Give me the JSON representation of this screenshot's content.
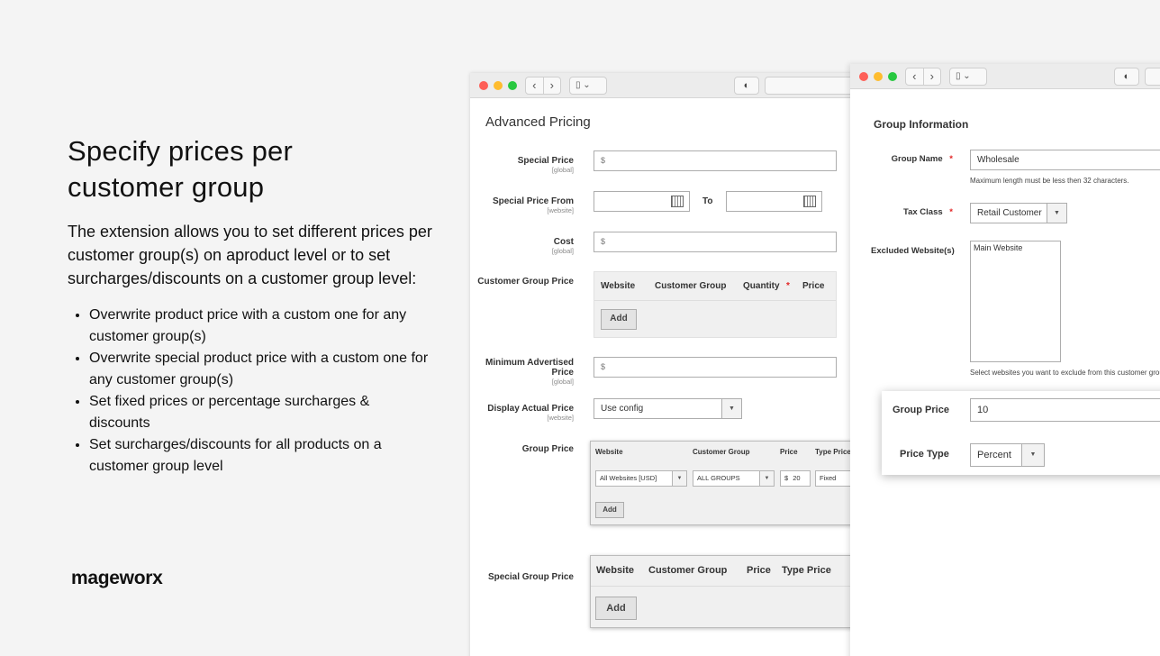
{
  "marketing": {
    "headline": "Specify prices per customer group",
    "intro": "The extension allows you to set different prices per customer group(s) on aproduct level or to set surcharges/discounts on a customer group level:",
    "bullets": [
      "Overwrite product price with a custom one for any customer group(s)",
      "Overwrite special product price with a custom one for any customer group(s)",
      "Set fixed prices or percentage surcharges & discounts",
      "Set surcharges/discounts for all products on a customer group level"
    ],
    "brand": "mageworx"
  },
  "browser": {
    "back_glyph": "‹",
    "forward_glyph": "›",
    "sidebar_glyph": "▯ ⌄",
    "shield_glyph": "◐"
  },
  "advanced_pricing": {
    "title": "Advanced Pricing",
    "special_price": {
      "label": "Special Price",
      "scope": "[global]",
      "prefix": "$"
    },
    "special_price_from": {
      "label": "Special Price From",
      "scope": "[website]",
      "to_label": "To"
    },
    "cost": {
      "label": "Cost",
      "scope": "[global]",
      "prefix": "$"
    },
    "customer_group_price": {
      "label": "Customer Group Price",
      "columns": [
        "Website",
        "Customer Group",
        "Quantity",
        "Price"
      ],
      "required_mark": "*",
      "add_label": "Add"
    },
    "map": {
      "label": "Minimum Advertised Price",
      "scope": "[global]",
      "prefix": "$"
    },
    "display_actual_price": {
      "label": "Display Actual Price",
      "scope": "[website]",
      "value": "Use config"
    },
    "group_price": {
      "label": "Group Price",
      "columns": [
        "Website",
        "Customer Group",
        "Price",
        "Type Price"
      ],
      "row": {
        "website": "All Websites [USD]",
        "group": "ALL GROUPS",
        "currency": "$",
        "price": "20",
        "type": "Fixed"
      },
      "add_label": "Add"
    },
    "special_group_price": {
      "label": "Special Group Price",
      "columns": [
        "Website",
        "Customer Group",
        "Price",
        "Type Price"
      ],
      "add_label": "Add"
    }
  },
  "group_information": {
    "title": "Group Information",
    "group_name": {
      "label": "Group Name",
      "required_mark": "*",
      "value": "Wholesale",
      "note": "Maximum length must be less then 32 characters."
    },
    "tax_class": {
      "label": "Tax Class",
      "required_mark": "*",
      "value": "Retail Customer"
    },
    "excluded_websites": {
      "label": "Excluded Website(s)",
      "option": "Main Website",
      "note": "Select websites you want to exclude from this customer group."
    }
  },
  "group_price_card": {
    "group_price_label": "Group Price",
    "group_price_value": "10",
    "price_type_label": "Price Type",
    "price_type_value": "Percent"
  },
  "colors": {
    "background": "#f4f4f4",
    "required": "#e22626",
    "close": "#fe5f57",
    "minimize": "#febc2e",
    "zoom": "#28c840"
  }
}
